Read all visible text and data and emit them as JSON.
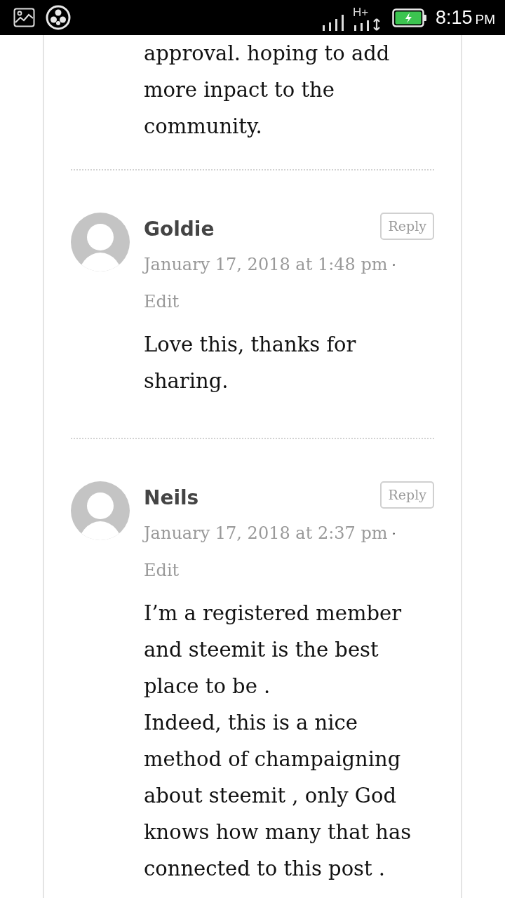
{
  "status_bar": {
    "network": "H+",
    "time": "8:15",
    "period": "PM"
  },
  "comments": [
    {
      "paragraphs": [
        "approval. hoping to add more inpact to the community."
      ]
    },
    {
      "author": "Goldie",
      "reply": "Reply",
      "date": "January 17, 2018 at 1:48 pm",
      "separator": "·",
      "edit": "Edit",
      "paragraphs": [
        "Love this, thanks for sharing."
      ]
    },
    {
      "author": "Neils",
      "reply": "Reply",
      "date": "January 17, 2018 at 2:37 pm",
      "separator": "·",
      "edit": "Edit",
      "paragraphs": [
        "I’m a registered member and steemit is the best place to be .",
        "Indeed, this is a nice method of champaigning about steemit , only God knows how many that has connected to this post ."
      ]
    }
  ]
}
